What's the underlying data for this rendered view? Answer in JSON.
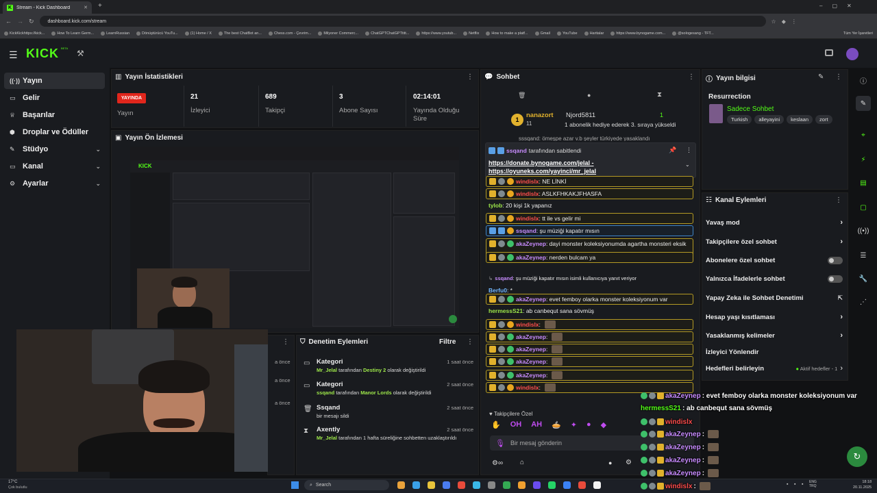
{
  "browser": {
    "tab_title": "Stream - Kick Dashboard",
    "new_tab": "+",
    "url": "dashboard.kick.com/stream",
    "bookmarks": [
      "KickKickhttps://kick...",
      "How To Learn Germ...",
      "LearnRussian",
      "Dönüştürücü YouTu...",
      "(1) Home / X",
      "The best ChatBot an...",
      "Chess.com - Çevrim...",
      "Milyoner Commerc...",
      "ChatGPTChatGPTtitt...",
      "https://www.youtub...",
      "Netflix",
      "How to make a platf...",
      "Gmail",
      "YouTube",
      "Haritalar",
      "https://www.bynogame.com...",
      "@sologesang - TFT..."
    ],
    "all_bookmarks": "Tüm Yer İşaretleri"
  },
  "header": {
    "logo": "KICK",
    "beta": "BETA"
  },
  "sidebar": {
    "items": [
      {
        "label": "Yayın",
        "icon": "broadcast-icon"
      },
      {
        "label": "Gelir",
        "icon": "wallet-icon"
      },
      {
        "label": "Başarılar",
        "icon": "trophy-icon"
      },
      {
        "label": "Droplar ve Ödüller",
        "icon": "gift-icon"
      },
      {
        "label": "Stüdyo",
        "icon": "brush-icon"
      },
      {
        "label": "Kanal",
        "icon": "tv-icon"
      },
      {
        "label": "Ayarlar",
        "icon": "gear-icon"
      }
    ]
  },
  "stats": {
    "title": "Yayın İstatistikleri",
    "live_badge": "YAYINDA",
    "live_label": "Yayın",
    "items": [
      {
        "value": "21",
        "label": "İzleyici"
      },
      {
        "value": "689",
        "label": "Takipçi"
      },
      {
        "value": "3",
        "label": "Abone Sayısı"
      },
      {
        "value": "02:14:01",
        "label": "Yayında Olduğu Süre"
      }
    ]
  },
  "preview": {
    "title": "Yayın Ön İzlemesi"
  },
  "moderation": {
    "title": "Denetim Eylemleri",
    "filter": "Filtre",
    "left_times": [
      "a önce",
      "a önce",
      "a önce"
    ],
    "rows": [
      {
        "title": "Kategori",
        "user": "Mr_Jelal",
        "mid": " tarafından ",
        "target": "Destiny 2",
        "tail": " olarak değiştirildi",
        "time": "1 saat önce",
        "icon": "folder-icon"
      },
      {
        "title": "Kategori",
        "user": "ssqand",
        "mid": " tarafından ",
        "target": "Manor Lords",
        "tail": " olarak değiştirildi",
        "time": "2 saat önce",
        "icon": "folder-icon"
      },
      {
        "title": "Ssqand",
        "user": "",
        "mid": "bir mesajı sildi",
        "target": "",
        "tail": "",
        "time": "2 saat önce",
        "icon": "trash-icon"
      },
      {
        "title": "Axently",
        "user": "Mr_Jelal",
        "mid": " tarafından 1 hafta süreliğine sohbetten uzaklaştırıldı",
        "target": "",
        "tail": "",
        "time": "2 saat önce",
        "icon": "hourglass-icon"
      }
    ]
  },
  "chat": {
    "title": "Sohbet",
    "gift": {
      "user": "nanazort",
      "count": "11",
      "recipient": "Njord5811",
      "qty": "1",
      "text": "1 abonelik hediye ederek 3. sıraya yükseldi"
    },
    "cutoff_text": "sssqand: ömeşpe azar v.b şeyler türkiyede yasaklandı",
    "pinned": {
      "by_user": "ssqand",
      "by_text": " tarafından sabitlendi",
      "link1": "https://donate.bynogame.com/jelal",
      "dash": " -",
      "link2": "https://oyuneks.com/yayinci/mr_jelal"
    },
    "messages": [
      {
        "user": "windislx",
        "text": ": NE LİNKİ",
        "style": "gold",
        "ucolor": "red"
      },
      {
        "user": "windislx",
        "text": ": ASLKFHKAKJFHASFA",
        "style": "gold",
        "ucolor": "red"
      },
      {
        "user": "tylob",
        "text": ": 20 kişi 1k yapanız",
        "style": "plain",
        "ucolor": "lime"
      },
      {
        "user": "windislx",
        "text": ": tt ile vs gelir mi",
        "style": "gold",
        "ucolor": "red"
      },
      {
        "user": "ssqand",
        "text": ": şu müziği kapatır mısın",
        "style": "blue",
        "ucolor": "vio"
      },
      {
        "user": "akaZeynep",
        "text": ": dayi monster koleksiyonumda agartha monsteri eksik",
        "style": "gold2",
        "ucolor": "vio"
      },
      {
        "user": "akaZeynep",
        "text": ": nerden bulcam ya",
        "style": "gold",
        "ucolor": "vio"
      },
      {
        "user": "ssqand",
        "text": ": şu müziği kapatır mısın isimli kullanıcıya yanıt veriyor",
        "style": "reply",
        "ucolor": "vio"
      },
      {
        "user": "Berfu0",
        "text": ": *",
        "style": "plain",
        "ucolor": "cy"
      },
      {
        "user": "akaZeynep",
        "text": ": evet femboy olarka monster koleksiyonum var",
        "style": "gold",
        "ucolor": "vio"
      },
      {
        "user": "hermessS21",
        "text": ": ab canbequt sana sövmüş",
        "style": "plain",
        "ucolor": "lime"
      },
      {
        "user": "windislx",
        "text": ":",
        "style": "gold",
        "ucolor": "red"
      },
      {
        "user": "akaZeynep",
        "text": ":",
        "style": "gold",
        "ucolor": "vio"
      },
      {
        "user": "akaZeynep",
        "text": ":",
        "style": "gold",
        "ucolor": "vio"
      },
      {
        "user": "akaZeynep",
        "text": ":",
        "style": "gold",
        "ucolor": "vio"
      },
      {
        "user": "akaZeynep",
        "text": ":",
        "style": "gold",
        "ucolor": "vio"
      },
      {
        "user": "windislx",
        "text": ":",
        "style": "gold",
        "ucolor": "red"
      }
    ],
    "followers_only": "Takipçilere Özel",
    "input_placeholder": "Bir mesaj gönderin"
  },
  "stream_info": {
    "title": "Yayın bilgisi",
    "game": "Resurrection",
    "category": "Sadece Sohbet",
    "tags": [
      "Turkish",
      "alleyayini",
      "keslaan",
      "zort"
    ]
  },
  "channel_actions": {
    "title": "Kanal Eylemleri",
    "rows": [
      {
        "label": "Yavaş mod",
        "ctl": "chevron"
      },
      {
        "label": "Takipçilere özel sohbet",
        "ctl": "chevron"
      },
      {
        "label": "Abonelere özel sohbet",
        "ctl": "toggle"
      },
      {
        "label": "Yalnızca İfadelerle sohbet",
        "ctl": "toggle"
      },
      {
        "label": "Yapay Zeka ile Sohbet Denetimi",
        "ctl": "ext"
      },
      {
        "label": "Hesap yaşı kısıtlaması",
        "ctl": "chevron"
      },
      {
        "label": "Yasaklanmış kelimeler",
        "ctl": "chevron"
      },
      {
        "label": "İzleyici Yönlendir",
        "ctl": "none"
      },
      {
        "label": "Hedefleri belirleyin",
        "ctl": "goals"
      }
    ],
    "goals_status": "Aktif hedefler - 1"
  },
  "overlay": {
    "lines": [
      {
        "user": "akaZeynep",
        "text": ": evet femboy olarka monster koleksiyonum var",
        "ucolor": "vio"
      },
      {
        "user": "hermessS21",
        "text": ": ab canbequt sana sövmüş",
        "ucolor": "grn"
      },
      {
        "user": "windislx",
        "text": "",
        "ucolor": "red"
      },
      {
        "user": "akaZeynep",
        "text": ":",
        "ucolor": "vio"
      },
      {
        "user": "akaZeynep",
        "text": ":",
        "ucolor": "vio"
      },
      {
        "user": "akaZeynep",
        "text": ":",
        "ucolor": "vio"
      },
      {
        "user": "akaZeynep",
        "text": ":",
        "ucolor": "vio"
      },
      {
        "user": "windislx",
        "text": ":",
        "ucolor": "red"
      }
    ]
  },
  "taskbar": {
    "weather_temp": "17°C",
    "weather_desc": "Çok bulutlu",
    "search": "Search",
    "lang1": "ENG",
    "lang2": "TRQ",
    "time": "18:18",
    "date": "20.11.2025"
  },
  "colors": {
    "accent": "#53fc18",
    "gold": "#b59b24",
    "blue": "#3f86c9",
    "panel": "#191b1f"
  }
}
